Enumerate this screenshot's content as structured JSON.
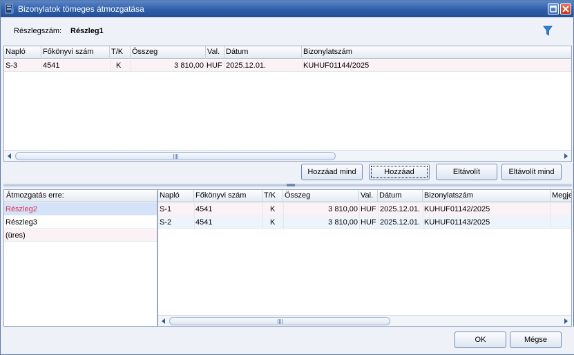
{
  "window": {
    "title": "Bizonylatok tömeges átmozgatása"
  },
  "reszleg": {
    "label": "Részlegszám:",
    "value": "Részleg1"
  },
  "columns": {
    "naplo": "Napló",
    "fokonyvi": "Főkönyvi szám",
    "tk": "T/K",
    "osszeg": "Összeg",
    "val": "Val.",
    "datum": "Dátum",
    "bizonylat": "Bizonylatszám",
    "megj": "Megje"
  },
  "top_grid": {
    "rows": [
      {
        "naplo": "S-3",
        "fokonyvi": "4541",
        "tk": "K",
        "osszeg": "3 810,00",
        "val": "HUF",
        "datum": "2025.12.01.",
        "bizonylat": "KUHUF01144/2025"
      }
    ]
  },
  "buttons": {
    "hozzaad_mind": "Hozzáad mind",
    "hozzaad": "Hozzáad",
    "eltavolit": "Eltávolít",
    "eltavolit_mind": "Eltávolít mind",
    "ok": "OK",
    "megse": "Mégse"
  },
  "target_list": {
    "header": "Átmozgatás erre:",
    "items": [
      "Részleg2",
      "Részleg3",
      "(üres)"
    ]
  },
  "bottom_grid": {
    "rows": [
      {
        "naplo": "S-1",
        "fokonyvi": "4541",
        "tk": "K",
        "osszeg": "3 810,00",
        "val": "HUF",
        "datum": "2025.12.01.",
        "bizonylat": "KUHUF01142/2025"
      },
      {
        "naplo": "S-2",
        "fokonyvi": "4541",
        "tk": "K",
        "osszeg": "3 810,00",
        "val": "HUF",
        "datum": "2025.12.01.",
        "bizonylat": "KUHUF01143/2025"
      }
    ]
  },
  "colors": {
    "titlebar": "#2f5ea8",
    "selected_text": "#e0304a",
    "selected_bg": "#d4e3f9"
  }
}
